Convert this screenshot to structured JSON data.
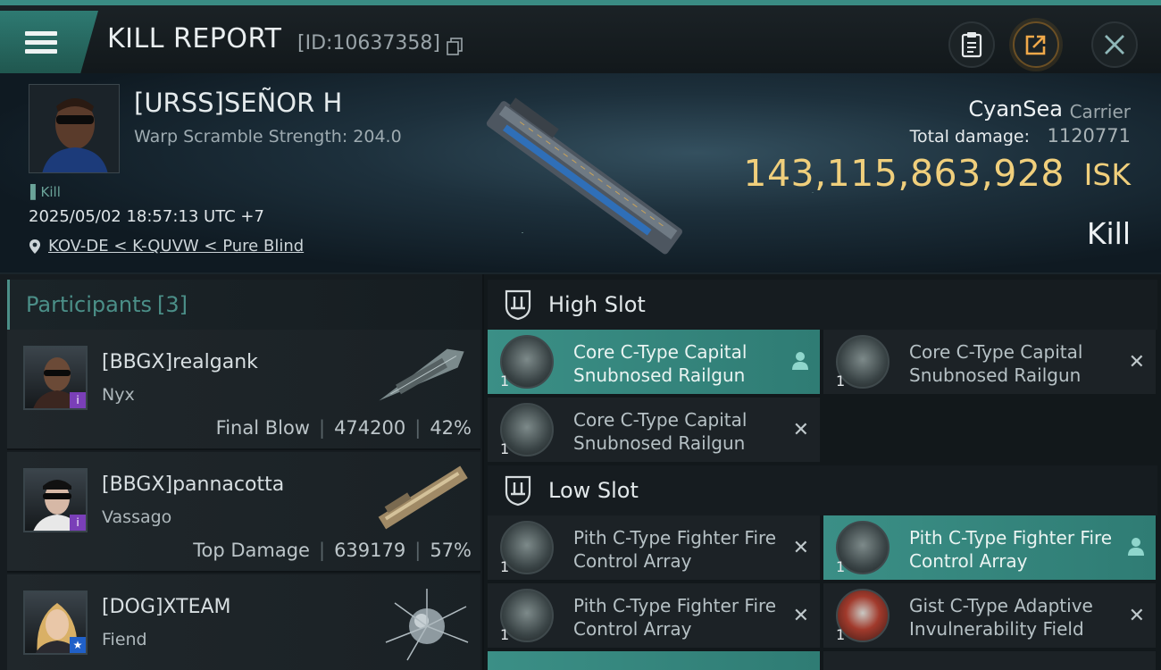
{
  "header": {
    "title": "KILL REPORT",
    "report_id": "[ID:10637358]"
  },
  "victim": {
    "name": "[URSS]SEÑOR H",
    "warp_text": "Warp Scramble Strength: 204.0",
    "tag": "Kill",
    "datetime": "2025/05/02 18:57:13 UTC +7",
    "location": "KOV-DE < K-QUVW < Pure Blind",
    "ship_name": "CyanSea",
    "ship_class": "Carrier",
    "damage_label": "Total damage:",
    "damage_value": "1120771",
    "isk_value": "143,115,863,928",
    "isk_unit": "ISK",
    "result": "Kill"
  },
  "participants": {
    "label": "Participants",
    "count": "[3]",
    "items": [
      {
        "name": "[BBGX]realgank",
        "ship": "Nyx",
        "role": "Final Blow",
        "damage": "474200",
        "pct": "42%",
        "badge": "i"
      },
      {
        "name": "[BBGX]pannacotta",
        "ship": "Vassago",
        "role": "Top Damage",
        "damage": "639179",
        "pct": "57%",
        "badge": "i"
      },
      {
        "name": "[DOG]XTEAM",
        "ship": "Fiend",
        "role": "",
        "damage": "",
        "pct": "",
        "badge": "★"
      }
    ]
  },
  "slots": {
    "high": {
      "label": "High Slot",
      "modules": [
        {
          "name": "Core C-Type Capital Snubnosed Railgun",
          "qty": "1",
          "state": "dropped"
        },
        {
          "name": "Core C-Type Capital Snubnosed Railgun",
          "qty": "1",
          "state": "destroyed"
        },
        {
          "name": "Core C-Type Capital Snubnosed Railgun",
          "qty": "1",
          "state": "destroyed"
        }
      ]
    },
    "low": {
      "label": "Low Slot",
      "modules": [
        {
          "name": "Pith C-Type Fighter Fire Control Array",
          "qty": "1",
          "state": "destroyed"
        },
        {
          "name": "Pith C-Type Fighter Fire Control Array",
          "qty": "1",
          "state": "dropped"
        },
        {
          "name": "Pith C-Type Fighter Fire Control Array",
          "qty": "1",
          "state": "destroyed"
        },
        {
          "name": "Gist C-Type Adaptive Invulnerability Field",
          "qty": "1",
          "state": "destroyed"
        }
      ]
    }
  },
  "icons": {
    "menu": "hamburger-icon",
    "copy": "copy-icon",
    "clipboard": "clipboard-icon",
    "share": "share-icon",
    "close": "close-icon",
    "location": "location-pin-icon",
    "dropped": "person-icon",
    "destroyed": "x-icon"
  },
  "colors": {
    "accent": "#3b8f86",
    "isk": "#f0cf7c",
    "badge_purple": "#7a3fb8",
    "badge_blue": "#2060c8"
  }
}
